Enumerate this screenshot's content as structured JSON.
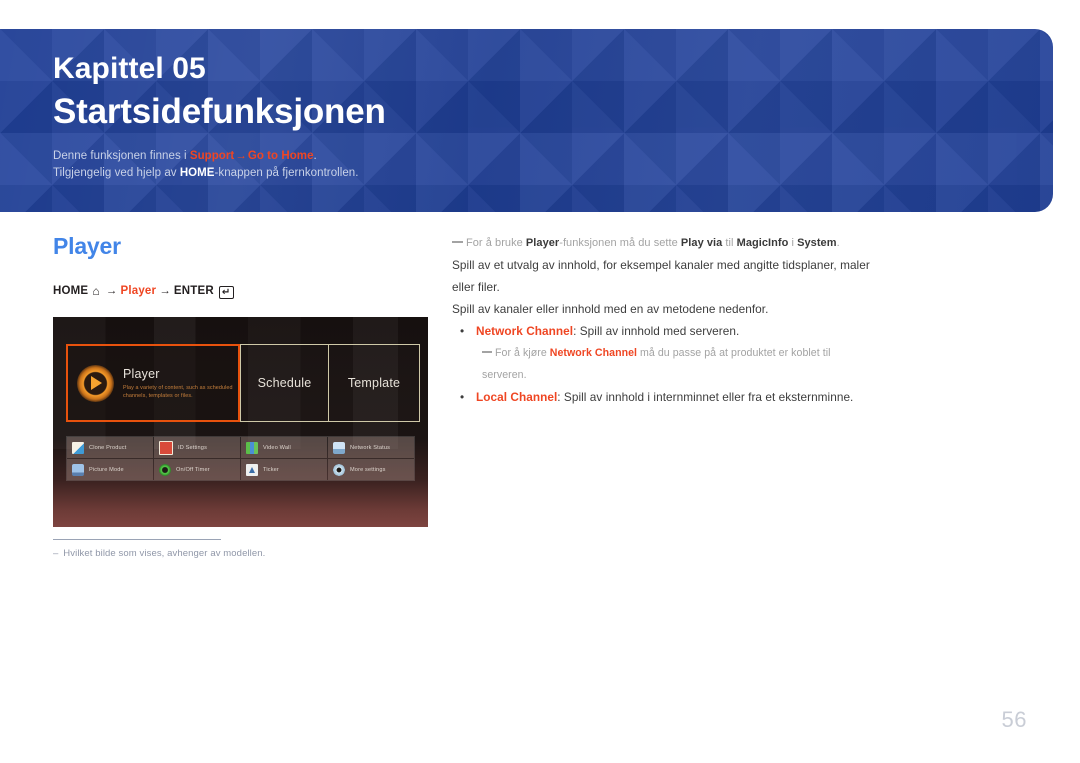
{
  "banner": {
    "chapter_label": "Kapittel 05",
    "chapter_title": "Startsidefunksjonen",
    "note_line1_pre": "Denne funksjonen finnes i ",
    "note_line1_link1": "Support",
    "note_line1_arrow": "→",
    "note_line1_link2": "Go to Home",
    "note_line1_post": ".",
    "note_line2_pre": "Tilgjengelig ved hjelp av ",
    "note_line2_kw": "HOME",
    "note_line2_post": "-knappen på fjernkontrollen."
  },
  "left": {
    "section_title": "Player",
    "nav": {
      "home": "HOME",
      "home_icon": "home-icon",
      "arrow1": "→",
      "player": "Player",
      "arrow2": "→",
      "enter": "ENTER",
      "enter_icon": "↵"
    },
    "footnote": {
      "dash": "–",
      "text": "Hvilket bilde som vises, avhenger av modellen."
    }
  },
  "tv_screenshot": {
    "tiles": [
      {
        "label": "Player",
        "desc": "Play a variety of content, such as scheduled channels, templates or files.",
        "selected": true
      },
      {
        "label": "Schedule",
        "desc": "",
        "selected": false
      },
      {
        "label": "Template",
        "desc": "",
        "selected": false
      }
    ],
    "grid": [
      {
        "label": "Clone Product",
        "icon": "clone-product-icon"
      },
      {
        "label": "ID Settings",
        "icon": "id-settings-icon"
      },
      {
        "label": "Video Wall",
        "icon": "video-wall-icon"
      },
      {
        "label": "Network Status",
        "icon": "network-status-icon"
      },
      {
        "label": "Picture Mode",
        "icon": "picture-mode-icon"
      },
      {
        "label": "On/Off Timer",
        "icon": "on-off-timer-icon"
      },
      {
        "label": "Ticker",
        "icon": "ticker-icon"
      },
      {
        "label": "More settings",
        "icon": "more-settings-icon"
      }
    ]
  },
  "right": {
    "note1": {
      "pre": "For å bruke ",
      "b1": "Player",
      "mid1": "-funksjonen må du sette ",
      "b2": "Play via",
      "mid2": " til ",
      "b3": "MagicInfo",
      "mid3": " i ",
      "b4": "System",
      "post": "."
    },
    "para1": "Spill av et utvalg av innhold, for eksempel kanaler med angitte tidsplaner, maler eller filer.",
    "para2": "Spill av kanaler eller innhold med en av metodene nedenfor.",
    "bullet1": {
      "dot": "•",
      "bold": "Network Channel",
      "rest": ": Spill av innhold med serveren."
    },
    "subnote1": {
      "pre": "For å kjøre ",
      "bold": "Network Channel",
      "post": " må du passe på at produktet er koblet til serveren."
    },
    "bullet2": {
      "dot": "•",
      "bold": "Local Channel",
      "rest": ": Spill av innhold i internminnet eller fra et eksternminne."
    }
  },
  "page_number": "56",
  "colors": {
    "banner_blue": "#20409a",
    "accent_red": "#ef4623",
    "section_blue": "#4285e8",
    "muted_gray": "#a3a3a3",
    "selection_orange": "#e8520d"
  }
}
